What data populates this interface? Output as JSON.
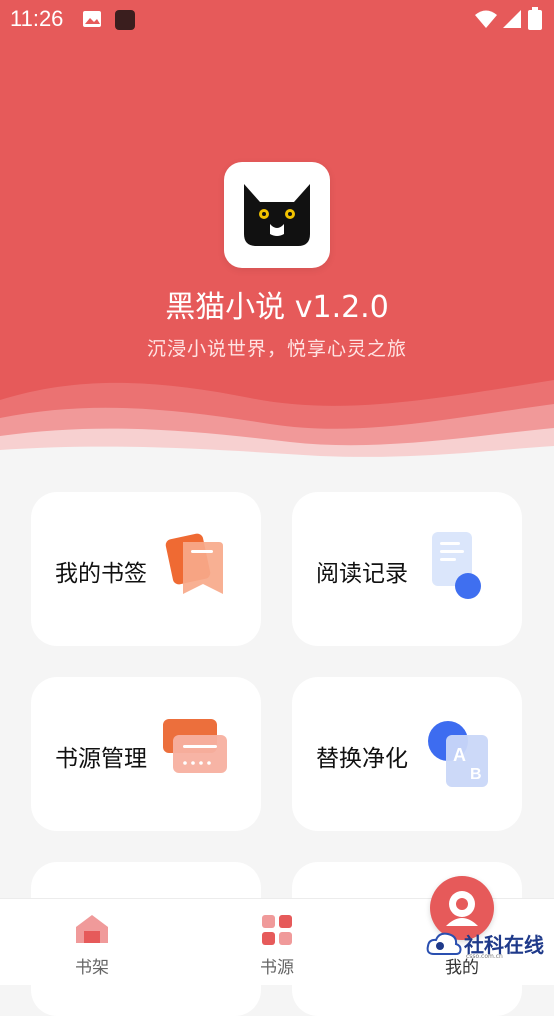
{
  "status_bar": {
    "time": "11:26"
  },
  "header": {
    "title": "黑猫小说 v1.2.0",
    "subtitle": "沉浸小说世界，悦享心灵之旅"
  },
  "menu": {
    "items": [
      {
        "label": "我的书签"
      },
      {
        "label": "阅读记录"
      },
      {
        "label": "书源管理"
      },
      {
        "label": "替换净化"
      }
    ]
  },
  "tabbar": {
    "tabs": [
      {
        "label": "书架"
      },
      {
        "label": "书源"
      },
      {
        "label": "我的"
      }
    ]
  },
  "watermark": {
    "text": "社科在线",
    "sub": "csso.com.cn"
  },
  "colors": {
    "accent": "#e65a5a",
    "background": "#f5f5f5",
    "card": "#ffffff"
  }
}
